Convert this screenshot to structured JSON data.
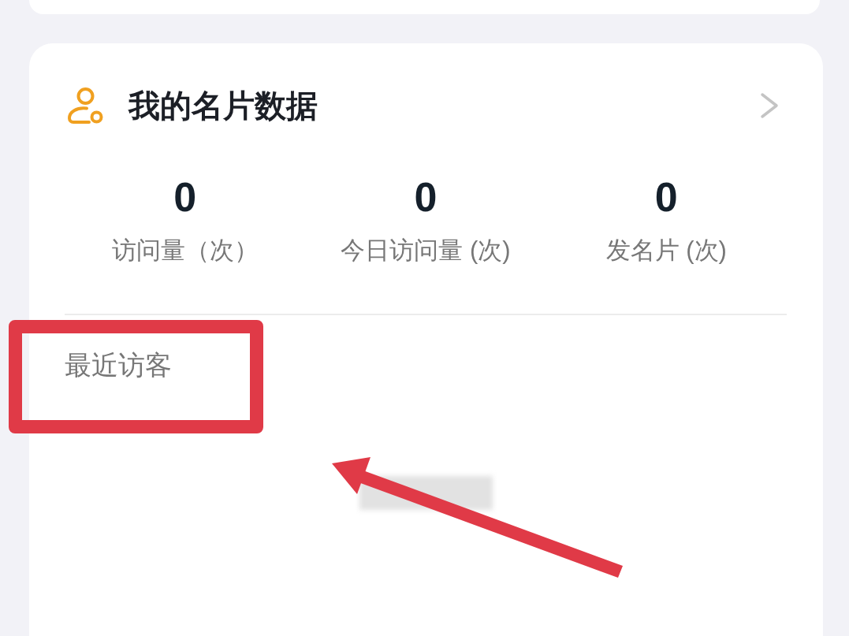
{
  "card": {
    "title": "我的名片数据",
    "stats": [
      {
        "value": "0",
        "label": "访问量（次）"
      },
      {
        "value": "0",
        "label": "今日访问量 (次)"
      },
      {
        "value": "0",
        "label": "发名片 (次)"
      }
    ],
    "recent_visitors": {
      "title": "最近访客"
    }
  },
  "annotations": {
    "highlight_box": true,
    "arrow": true
  }
}
